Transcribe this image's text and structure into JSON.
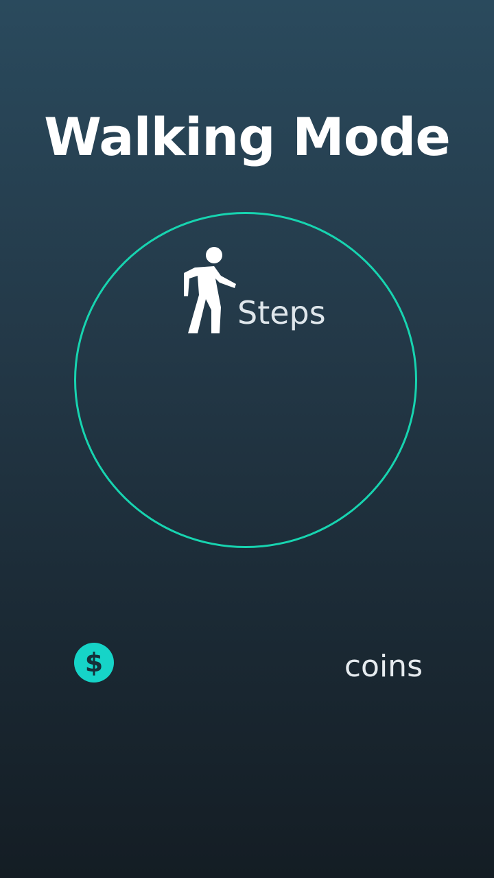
{
  "header": {
    "title": "Walking Mode"
  },
  "steps": {
    "icon": "walking-person-icon",
    "label": "Steps",
    "value": ""
  },
  "coins": {
    "icon": "dollar-coin-icon",
    "label": "coins",
    "value": ""
  },
  "colors": {
    "accent": "#17d4b0",
    "coin": "#16d4c8",
    "background_top": "#2a4a5d",
    "background_bottom": "#141d24",
    "text": "#ffffff"
  }
}
